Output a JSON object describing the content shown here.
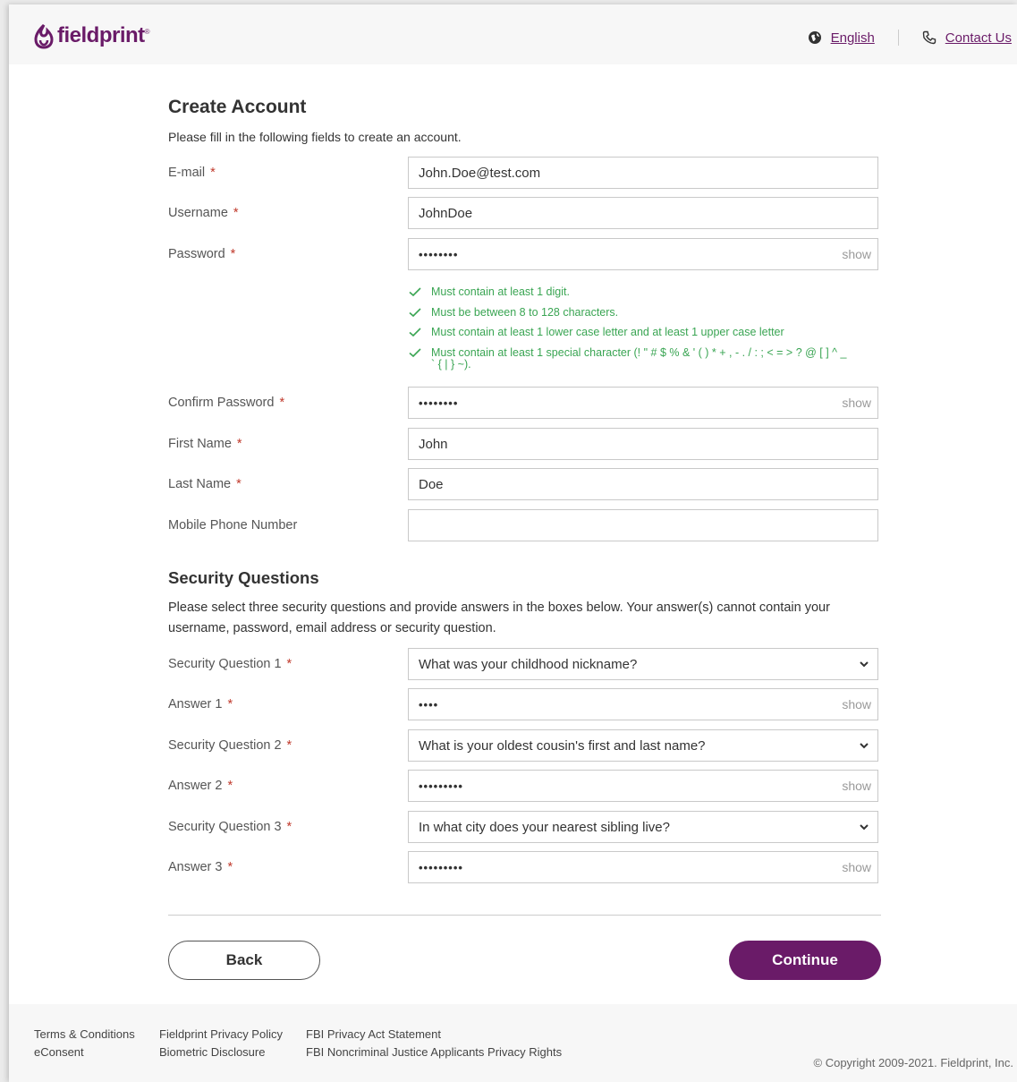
{
  "header": {
    "brand": "fieldprint",
    "trademark": "®",
    "language_label": "English",
    "contact_label": "Contact Us"
  },
  "form": {
    "title": "Create Account",
    "subtitle": "Please fill in the following fields to create an account.",
    "show_label": "show",
    "required_mark": "*",
    "email": {
      "label": "E-mail",
      "value": "John.Doe@test.com"
    },
    "username": {
      "label": "Username",
      "value": "JohnDoe"
    },
    "password": {
      "label": "Password",
      "value": "••••••••"
    },
    "password_requirements": [
      "Must contain at least 1 digit.",
      "Must be between 8 to 128 characters.",
      "Must contain at least 1 lower case letter and at least 1 upper case letter",
      "Must contain at least 1 special character (! \" # $ % & ' ( ) * + , - . / : ; < = > ? @ [ ] ^ _"
    ],
    "password_requirements_continuation": "` { | } ~).",
    "confirm_password": {
      "label": "Confirm Password",
      "value": "••••••••"
    },
    "first_name": {
      "label": "First Name",
      "value": "John"
    },
    "last_name": {
      "label": "Last Name",
      "value": "Doe"
    },
    "mobile_phone": {
      "label": "Mobile Phone Number",
      "value": ""
    }
  },
  "security": {
    "title": "Security Questions",
    "description": "Please select three security questions and provide answers in the boxes below. Your answer(s) cannot contain your username, password, email address or security question.",
    "q1": {
      "label": "Security Question 1",
      "value": "What was your childhood nickname?"
    },
    "a1": {
      "label": "Answer 1",
      "value": "••••"
    },
    "q2": {
      "label": "Security Question 2",
      "value": "What is your oldest cousin's first and last name?"
    },
    "a2": {
      "label": "Answer 2",
      "value": "•••••••••"
    },
    "q3": {
      "label": "Security Question 3",
      "value": "In what city does your nearest sibling live?"
    },
    "a3": {
      "label": "Answer 3",
      "value": "•••••••••"
    }
  },
  "buttons": {
    "back": "Back",
    "continue": "Continue"
  },
  "footer": {
    "col1": [
      "Terms & Conditions",
      "eConsent"
    ],
    "col2": [
      "Fieldprint Privacy Policy",
      "Biometric Disclosure"
    ],
    "col3": [
      "FBI Privacy Act Statement",
      "FBI Noncriminal Justice Applicants Privacy Rights"
    ],
    "copyright": "© Copyright 2009-2021. Fieldprint, Inc."
  },
  "colors": {
    "brand": "#6a1b68",
    "success": "#3aa553",
    "required": "#c0392b"
  }
}
